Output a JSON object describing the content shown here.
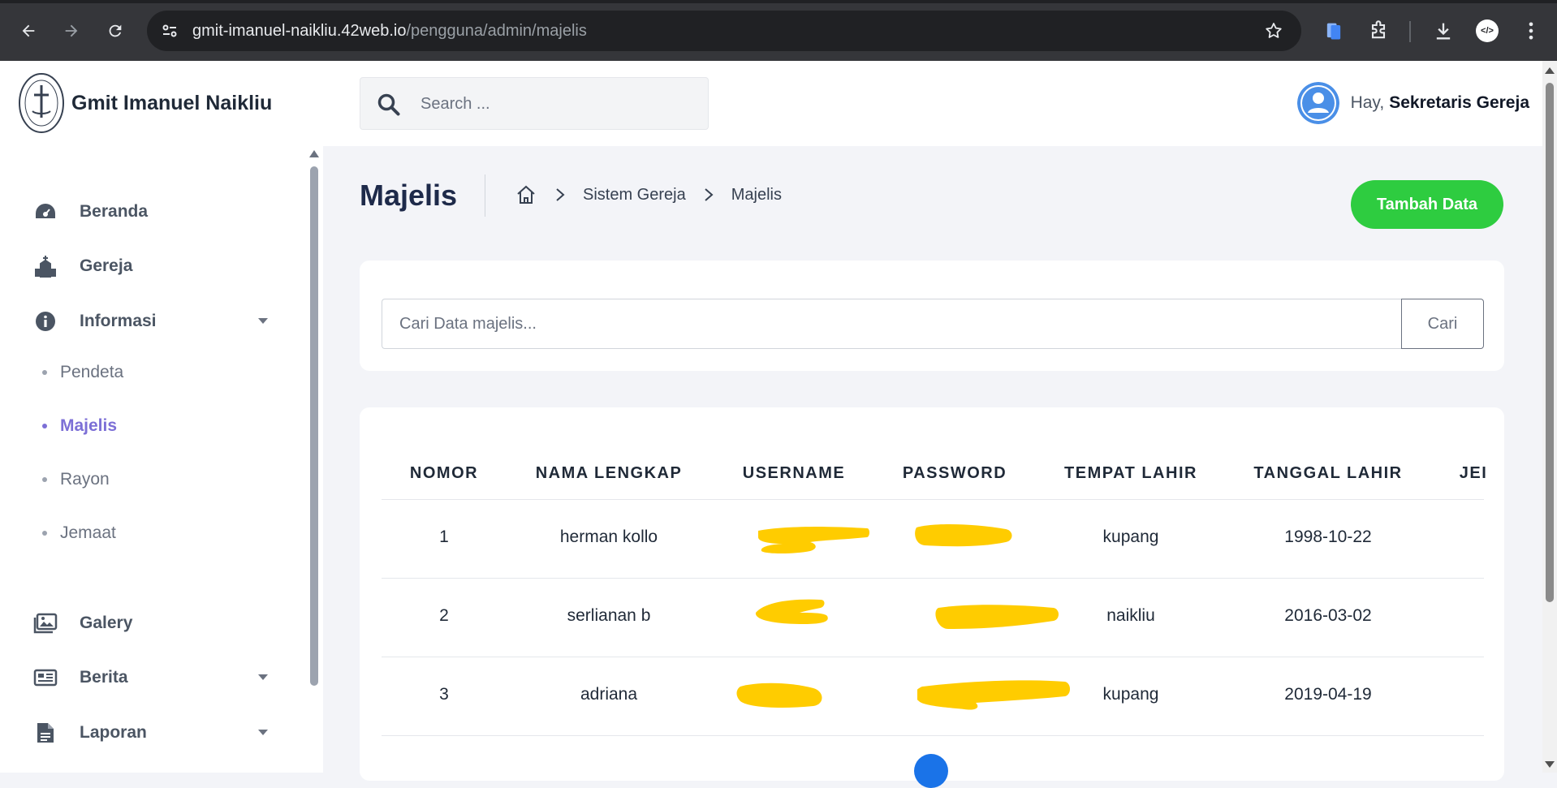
{
  "browser": {
    "url_host": "gmit-imanuel-naikliu.42web.io",
    "url_path": "/pengguna/admin/majelis",
    "icons": [
      "back-icon",
      "forward-icon",
      "reload-icon",
      "site-info-icon",
      "star-icon",
      "extension-icon",
      "puzzle-icon",
      "download-icon",
      "menu-icon"
    ]
  },
  "sidebar": {
    "brand": "Gmit Imanuel Naikliu",
    "items": [
      {
        "label": "Beranda",
        "icon": "dashboard-icon"
      },
      {
        "label": "Gereja",
        "icon": "church-icon"
      },
      {
        "label": "Informasi",
        "icon": "info-icon",
        "expanded": true
      },
      {
        "label": "Galery",
        "icon": "gallery-icon"
      },
      {
        "label": "Berita",
        "icon": "news-icon"
      },
      {
        "label": "Laporan",
        "icon": "report-icon"
      }
    ],
    "subitems": [
      {
        "label": "Pendeta"
      },
      {
        "label": "Majelis",
        "active": true
      },
      {
        "label": "Rayon"
      },
      {
        "label": "Jemaat"
      }
    ]
  },
  "header": {
    "search_placeholder": "Search ...",
    "greeting": "Hay,",
    "user_name": "Sekretaris Gereja"
  },
  "page": {
    "title": "Majelis",
    "breadcrumb": [
      "Sistem Gereja",
      "Majelis"
    ],
    "add_button": "Tambah Data"
  },
  "filter": {
    "placeholder": "Cari Data majelis...",
    "button": "Cari"
  },
  "table": {
    "columns": [
      "NOMOR",
      "NAMA LENGKAP",
      "USERNAME",
      "PASSWORD",
      "TEMPAT LAHIR",
      "TANGGAL LAHIR",
      "JEI"
    ],
    "rows": [
      {
        "nomor": "1",
        "nama": "herman kollo",
        "tempat": "kupang",
        "tanggal": "1998-10-22"
      },
      {
        "nomor": "2",
        "nama": "serlianan b",
        "tempat": "naikliu",
        "tanggal": "2016-03-02"
      },
      {
        "nomor": "3",
        "nama": "adriana",
        "tempat": "kupang",
        "tanggal": "2019-04-19"
      }
    ]
  },
  "colors": {
    "accent_green": "#2ecc40",
    "active_purple": "#7c6fd6",
    "redaction": "#ffcc00",
    "title_navy": "#1e2a4a"
  }
}
